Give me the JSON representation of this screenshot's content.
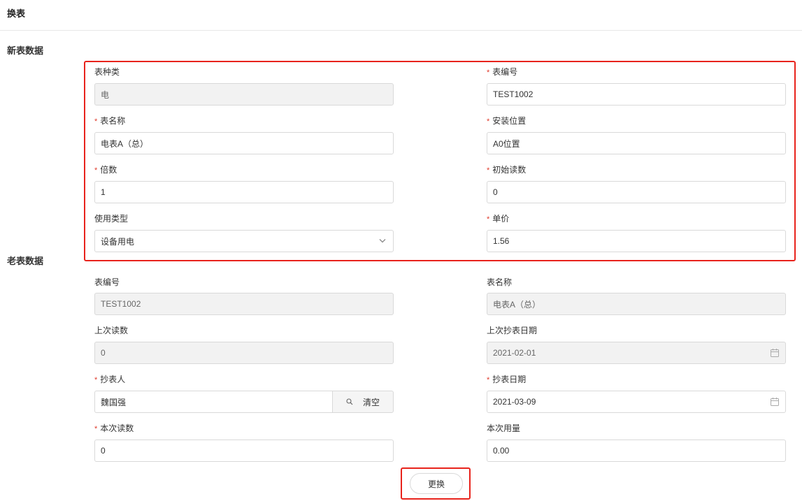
{
  "page": {
    "title": "换表"
  },
  "new_meter": {
    "section_title": "新表数据",
    "meter_type": {
      "label": "表种类",
      "value": "电"
    },
    "meter_no": {
      "label": "表编号",
      "value": "TEST1002"
    },
    "meter_name": {
      "label": "表名称",
      "value": "电表A（总）"
    },
    "install_location": {
      "label": "安装位置",
      "value": "A0位置"
    },
    "multiplier": {
      "label": "倍数",
      "value": "1"
    },
    "initial_reading": {
      "label": "初始读数",
      "value": "0"
    },
    "usage_type": {
      "label": "使用类型",
      "value": "设备用电"
    },
    "unit_price": {
      "label": "单价",
      "value": "1.56"
    }
  },
  "old_meter": {
    "section_title": "老表数据",
    "meter_no": {
      "label": "表编号",
      "value": "TEST1002"
    },
    "meter_name": {
      "label": "表名称",
      "value": "电表A（总）"
    },
    "last_reading": {
      "label": "上次读数",
      "value": "0"
    },
    "last_read_date": {
      "label": "上次抄表日期",
      "value": "2021-02-01"
    },
    "reader": {
      "label": "抄表人",
      "value": "魏国强",
      "clear_label": "清空"
    },
    "read_date": {
      "label": "抄表日期",
      "value": "2021-03-09"
    },
    "current_reading": {
      "label": "本次读数",
      "value": "0"
    },
    "current_usage": {
      "label": "本次用量",
      "value": "0.00"
    }
  },
  "actions": {
    "swap_label": "更换"
  },
  "colors": {
    "required_mark": "#e03c2d",
    "highlight": "#e8231c",
    "disabled_bg": "#f2f2f2"
  },
  "icons": {
    "date": "calendar-icon",
    "select": "chevron-down-icon",
    "search": "search-icon"
  }
}
